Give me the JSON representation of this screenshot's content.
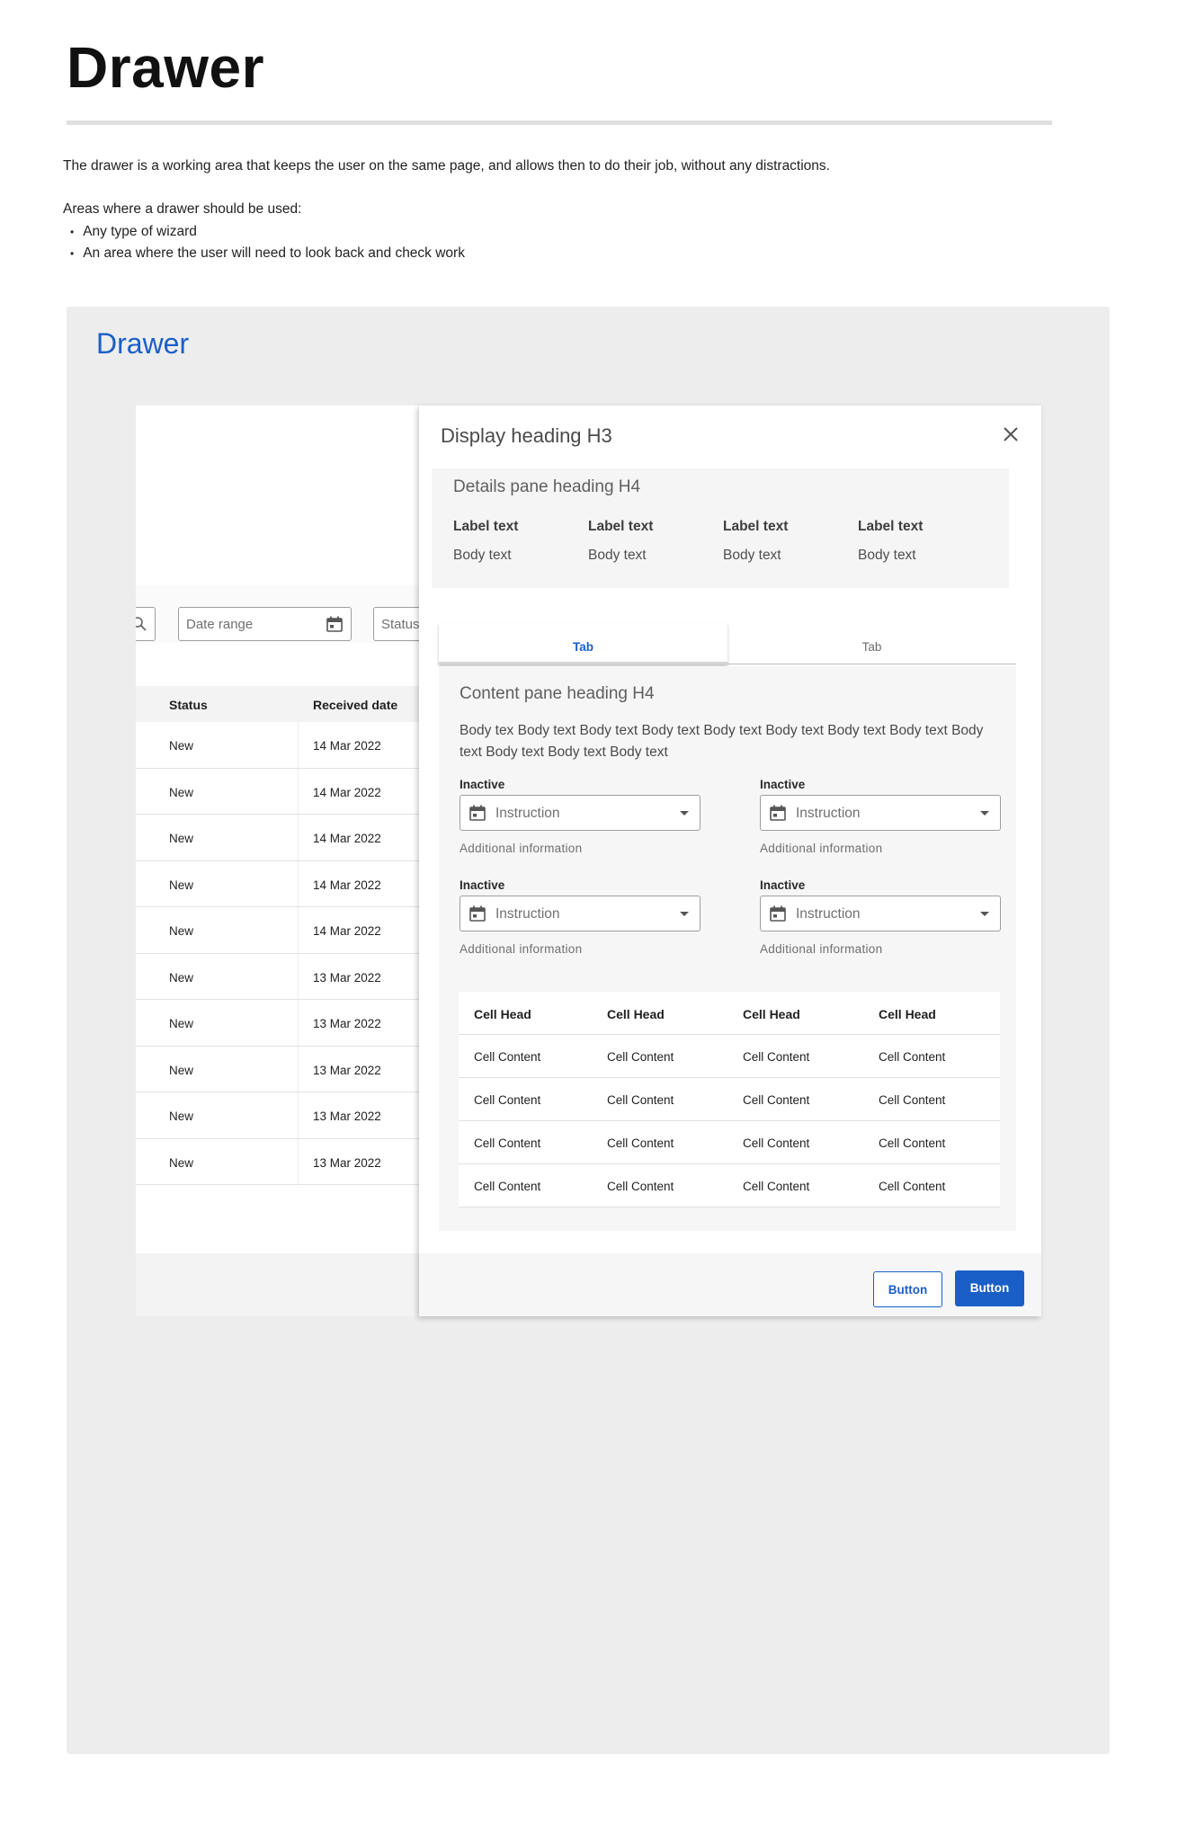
{
  "doc": {
    "title": "Drawer",
    "intro": "The drawer is a working area that keeps the user on the same page, and allows then to do their job, without any distractions.",
    "areas_label": "Areas where a drawer should be used:",
    "bullets": [
      "Any type of wizard",
      "An area where the user will need to look back and check work"
    ]
  },
  "showcase": {
    "title": "Drawer"
  },
  "app": {
    "filters": {
      "date_range": "Date range",
      "status": "Status"
    },
    "table": {
      "headers": [
        "Status",
        "Received date"
      ],
      "rows": [
        [
          "New",
          "14 Mar 2022"
        ],
        [
          "New",
          "14 Mar 2022"
        ],
        [
          "New",
          "14 Mar 2022"
        ],
        [
          "New",
          "14 Mar 2022"
        ],
        [
          "New",
          "14 Mar 2022"
        ],
        [
          "New",
          "13 Mar 2022"
        ],
        [
          "New",
          "13 Mar 2022"
        ],
        [
          "New",
          "13 Mar 2022"
        ],
        [
          "New",
          "13 Mar 2022"
        ],
        [
          "New",
          "13 Mar 2022"
        ]
      ]
    }
  },
  "drawer": {
    "title": "Display heading H3",
    "details": {
      "heading": "Details pane heading H4",
      "items": [
        {
          "label": "Label text",
          "body": "Body text"
        },
        {
          "label": "Label text",
          "body": "Body text"
        },
        {
          "label": "Label text",
          "body": "Body text"
        },
        {
          "label": "Label text",
          "body": "Body text"
        }
      ]
    },
    "tabs": [
      "Tab",
      "Tab"
    ],
    "content": {
      "heading": "Content pane heading H4",
      "body": "Body tex Body text Body text Body text Body text Body text Body text Body text Body text Body text Body text Body text",
      "fields": [
        {
          "label": "Inactive",
          "placeholder": "Instruction",
          "help": "Additional information"
        },
        {
          "label": "Inactive",
          "placeholder": "Instruction",
          "help": "Additional information"
        },
        {
          "label": "Inactive",
          "placeholder": "Instruction",
          "help": "Additional information"
        },
        {
          "label": "Inactive",
          "placeholder": "Instruction",
          "help": "Additional information"
        }
      ],
      "table": {
        "headers": [
          "Cell Head",
          "Cell Head",
          "Cell Head",
          "Cell Head"
        ],
        "rows": [
          [
            "Cell Content",
            "Cell Content",
            "Cell Content",
            "Cell Content"
          ],
          [
            "Cell Content",
            "Cell Content",
            "Cell Content",
            "Cell Content"
          ],
          [
            "Cell Content",
            "Cell Content",
            "Cell Content",
            "Cell Content"
          ],
          [
            "Cell Content",
            "Cell Content",
            "Cell Content",
            "Cell Content"
          ]
        ]
      }
    },
    "footer": {
      "secondary_label": "Button",
      "primary_label": "Button"
    }
  },
  "icons": {
    "close": "close-icon",
    "calendar": "calendar-icon",
    "search": "search-icon",
    "dropdown": "caret-down-icon"
  },
  "colors": {
    "accent": "#1a5fc7",
    "panel": "#ededed"
  }
}
